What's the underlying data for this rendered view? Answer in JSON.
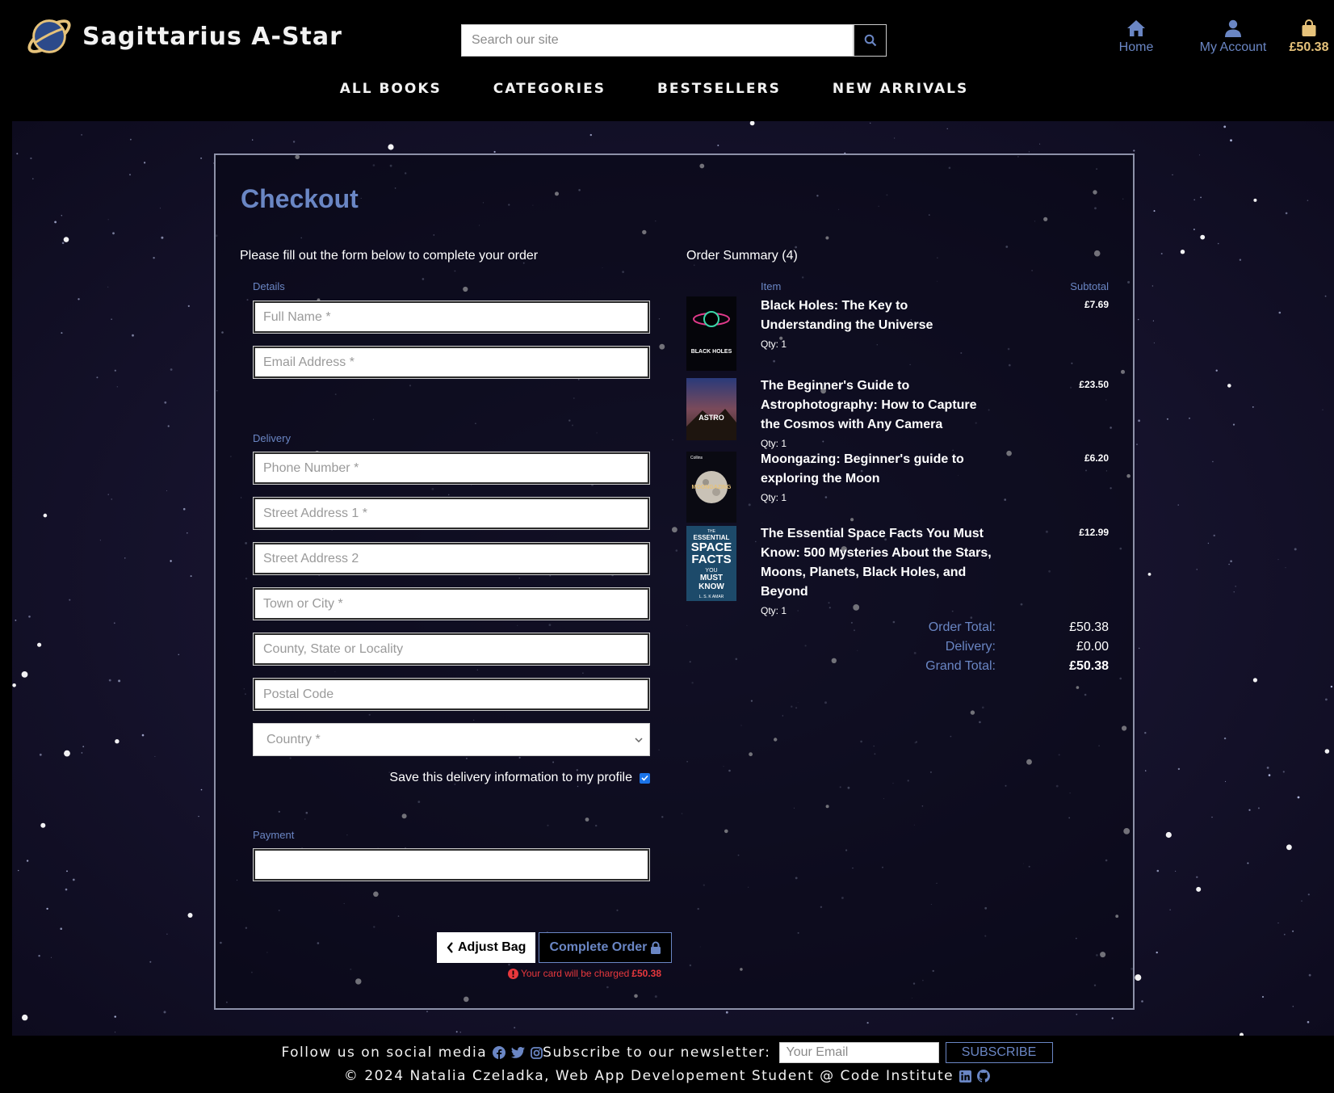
{
  "site": {
    "name": "Sagittarius A-Star"
  },
  "search": {
    "placeholder": "Search our site"
  },
  "header_nav": {
    "home": "Home",
    "account": "My Account",
    "bag_total": "£50.38"
  },
  "main_nav": [
    "ALL BOOKS",
    "CATEGORIES",
    "BESTSELLERS",
    "NEW ARRIVALS"
  ],
  "checkout": {
    "title": "Checkout",
    "intro": "Please fill out the form below to complete your order",
    "details_label": "Details",
    "delivery_label": "Delivery",
    "payment_label": "Payment",
    "fields": {
      "full_name": "Full Name *",
      "email": "Email Address *",
      "phone": "Phone Number *",
      "street1": "Street Address 1 *",
      "street2": "Street Address 2",
      "town": "Town or City *",
      "county": "County, State or Locality",
      "postcode": "Postal Code",
      "country": "Country *"
    },
    "save_info": "Save this delivery information to my profile",
    "adjust_bag": "Adjust Bag",
    "complete_order": "Complete Order",
    "charge_note": "Your card will be charged",
    "charge_amount": "£50.38"
  },
  "summary": {
    "title": "Order Summary (4)",
    "col_item": "Item",
    "col_subtotal": "Subtotal",
    "items": [
      {
        "title": "Black Holes: The Key to Understanding the Universe",
        "qty": "Qty: 1",
        "price": "£7.69"
      },
      {
        "title": "The Beginner's Guide to Astrophotography: How to Capture the Cosmos with Any Camera",
        "qty": "Qty: 1",
        "price": "£23.50"
      },
      {
        "title": "Moongazing: Beginner's guide to exploring the Moon",
        "qty": "Qty: 1",
        "price": "£6.20"
      },
      {
        "title": "The Essential Space Facts You Must Know: 500 Mysteries About the Stars, Moons, Planets, Black Holes, and Beyond",
        "qty": "Qty: 1",
        "price": "£12.99"
      }
    ],
    "order_total_label": "Order Total:",
    "order_total": "£50.38",
    "delivery_label": "Delivery:",
    "delivery": "£0.00",
    "grand_total_label": "Grand Total:",
    "grand_total": "£50.38"
  },
  "covers": {
    "c1": {
      "line1": "BLACK HOLES"
    },
    "c2": {
      "line1": "ASTRO"
    },
    "c3": {
      "line1": "Collins",
      "line2": "MOONGAZING"
    },
    "c4": {
      "line1": "THE",
      "line2": "ESSENTIAL",
      "line3": "SPACE",
      "line4": "FACTS",
      "line5": "YOU",
      "line6": "MUST",
      "line7": "KNOW",
      "line8": "L. S. K AMAR"
    }
  },
  "footer": {
    "follow": "Follow us on social media",
    "subscribe_text": "Subscribe to our newsletter:",
    "email_placeholder": "Your Email",
    "subscribe_btn": "SUBSCRIBE",
    "copyright": "© 2024 Natalia Czeladka, Web App Developement Student @ Code Institute"
  },
  "colors": {
    "accent": "#6a86c4",
    "bag": "#e6c27a",
    "error": "#e8383d",
    "background": "#000000"
  }
}
